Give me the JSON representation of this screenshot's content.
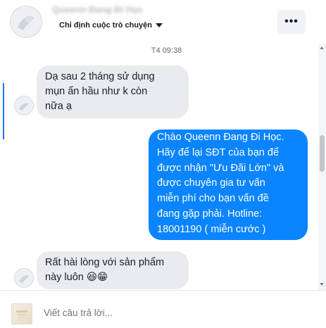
{
  "header": {
    "contact_name": "Queenn Đang Đi Học",
    "nicknames_label": "Chỉ định cuộc trò chuyện",
    "more_label": "•••"
  },
  "thread": {
    "timestamp": "T4 09:38",
    "messages": [
      {
        "direction": "incoming",
        "lines": [
          "Dạ sau 2 tháng sử dụng",
          "mụn ẩn hầu như k còn",
          "nữa ạ"
        ]
      },
      {
        "direction": "outgoing",
        "lines": [
          "Chào Queenn Đang Đi Học.",
          "Hãy để lại SĐT của bạn để",
          "được nhận \"Ưu Đãi Lớn\" và",
          "được chuyên gia tư vấn",
          "miễn phí cho bạn vấn đề",
          "đang gặp phải. Hotline:",
          "18001190 ( miễn cước )"
        ]
      },
      {
        "direction": "incoming",
        "lines": [
          "Rất hài lòng với sản phẩm",
          "này luôn 😆😁"
        ]
      }
    ]
  },
  "composer": {
    "placeholder": "Viết câu trả lời..."
  },
  "colors": {
    "outgoing_bubble": "#0a84ff",
    "incoming_bubble": "#e9ebee",
    "accent": "#1877f2"
  }
}
